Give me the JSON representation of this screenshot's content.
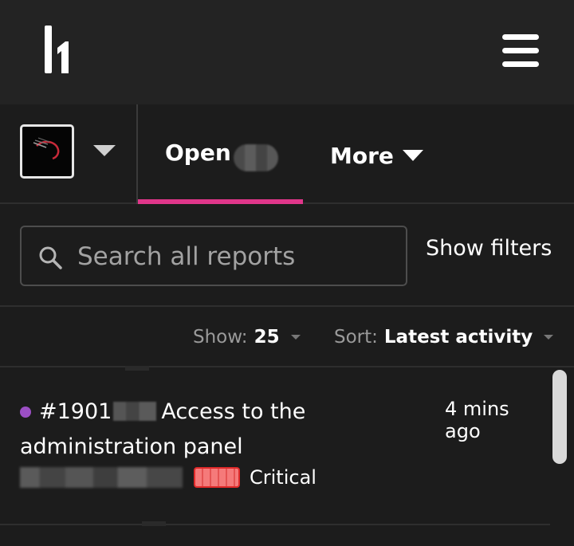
{
  "header": {
    "logo_icon": "hackerone-logo-icon",
    "menu_icon": "hamburger-menu-icon"
  },
  "tabs": {
    "open_label": "Open",
    "more_label": "More",
    "accent_color": "#e0368a"
  },
  "search": {
    "placeholder": "Search all reports",
    "value": "",
    "show_filters_label": "Show filters"
  },
  "controls": {
    "show_label": "Show:",
    "show_value": "25",
    "sort_label": "Sort:",
    "sort_value": "Latest activity"
  },
  "reports": [
    {
      "id_prefix": "#1901",
      "title": "Access to the administration panel",
      "time": "4 mins ago",
      "state_color": "#9b4fc4",
      "severity": "Critical",
      "severity_color": "#e02a2a"
    }
  ]
}
